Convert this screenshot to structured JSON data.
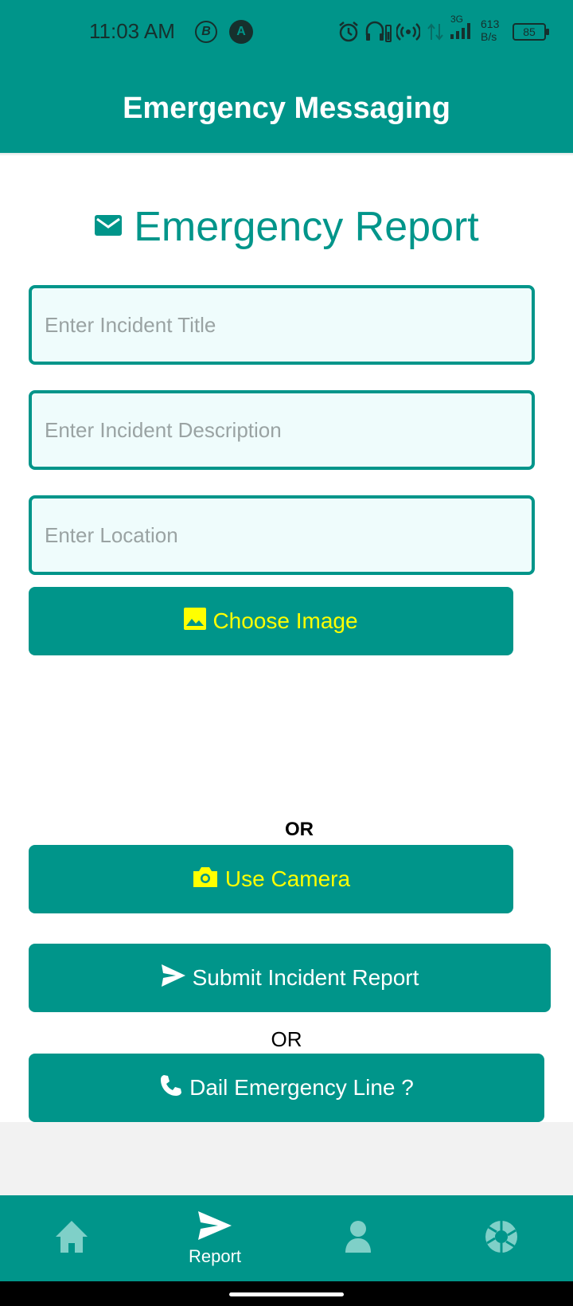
{
  "status_bar": {
    "time": "11:03 AM",
    "icon_b": "B",
    "icon_a": "A",
    "network_type": "3G",
    "speed_value": "613",
    "speed_unit": "B/s",
    "battery": "85"
  },
  "app_bar": {
    "title": "Emergency Messaging"
  },
  "form": {
    "heading": "Emergency Report",
    "title_placeholder": "Enter Incident Title",
    "description_placeholder": "Enter Incident Description",
    "location_placeholder": "Enter Location",
    "choose_image_label": "Choose Image",
    "or_label_1": "OR",
    "use_camera_label": "Use Camera",
    "submit_label": "Submit Incident Report",
    "or_label_2": "OR",
    "dial_label": "Dail Emergency Line ?"
  },
  "bottom_nav": {
    "items": [
      {
        "icon": "home-icon",
        "label": ""
      },
      {
        "icon": "send-icon",
        "label": "Report"
      },
      {
        "icon": "person-icon",
        "label": ""
      },
      {
        "icon": "camera-shutter-icon",
        "label": ""
      }
    ]
  },
  "colors": {
    "primary": "#00958a",
    "accent_text": "#ffff00",
    "field_bg": "#effcfc"
  }
}
